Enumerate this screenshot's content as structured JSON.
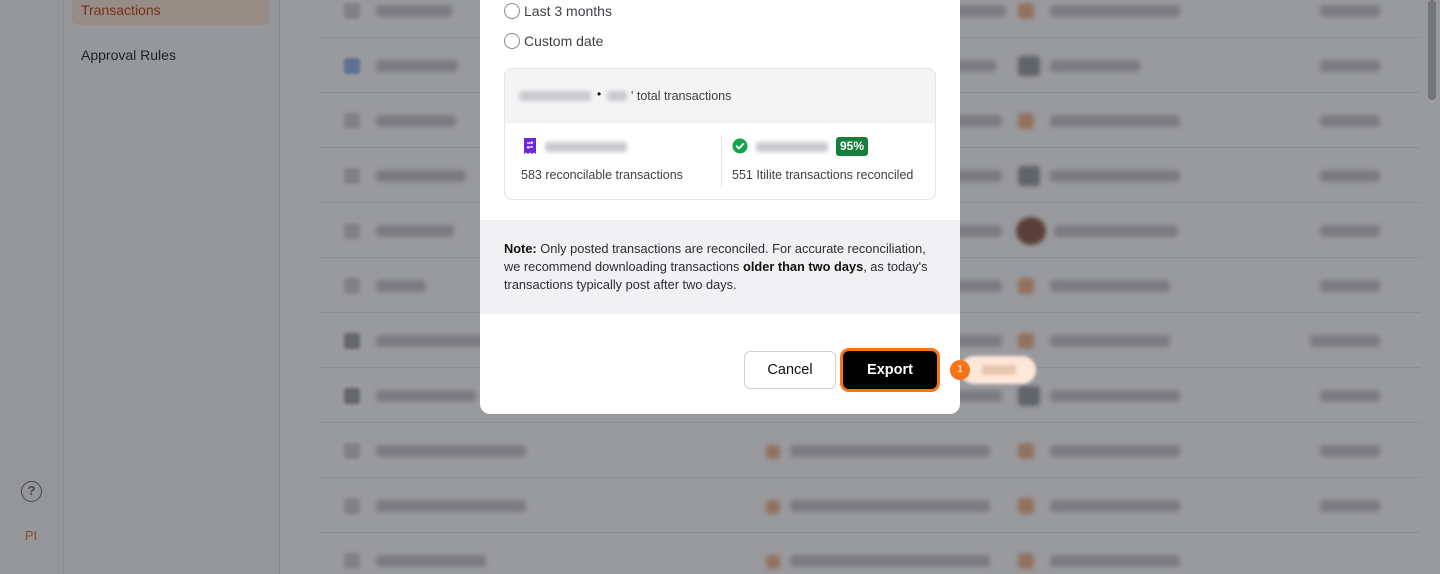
{
  "sidebar": {
    "items": [
      {
        "label": "Transactions",
        "active": true
      },
      {
        "label": "Approval Rules",
        "active": false
      }
    ],
    "help_icon": "question-circle-icon",
    "avatar_initials": "PI"
  },
  "export_dialog": {
    "range_options": [
      {
        "label": "Last 3 months",
        "selected": false
      },
      {
        "label": "Custom date",
        "selected": false
      }
    ],
    "summary": {
      "separator": "•",
      "total_suffix": "' total transactions",
      "reconcilable_caption": "583 reconcilable transactions",
      "reconciled_caption": "551 Itilite transactions reconciled",
      "reconciled_percent": "95%",
      "reconcilable_icon": "receipt-icon",
      "reconciled_icon": "check-circle-icon"
    },
    "note": {
      "label": "Note:",
      "text_1": " Only posted transactions are reconciled. For accurate reconciliation, we recommend downloading transactions ",
      "emphasis": "older than two days",
      "text_2": ", as today's transactions typically post after two days."
    },
    "cancel_label": "Cancel",
    "export_label": "Export"
  },
  "walkthrough": {
    "step_number": "1"
  },
  "colors": {
    "accent": "#f97316",
    "active_nav_bg": "#fde6d8",
    "active_nav_text": "#c2410c",
    "success": "#15803d",
    "receipt_icon": "#6d28d9"
  }
}
